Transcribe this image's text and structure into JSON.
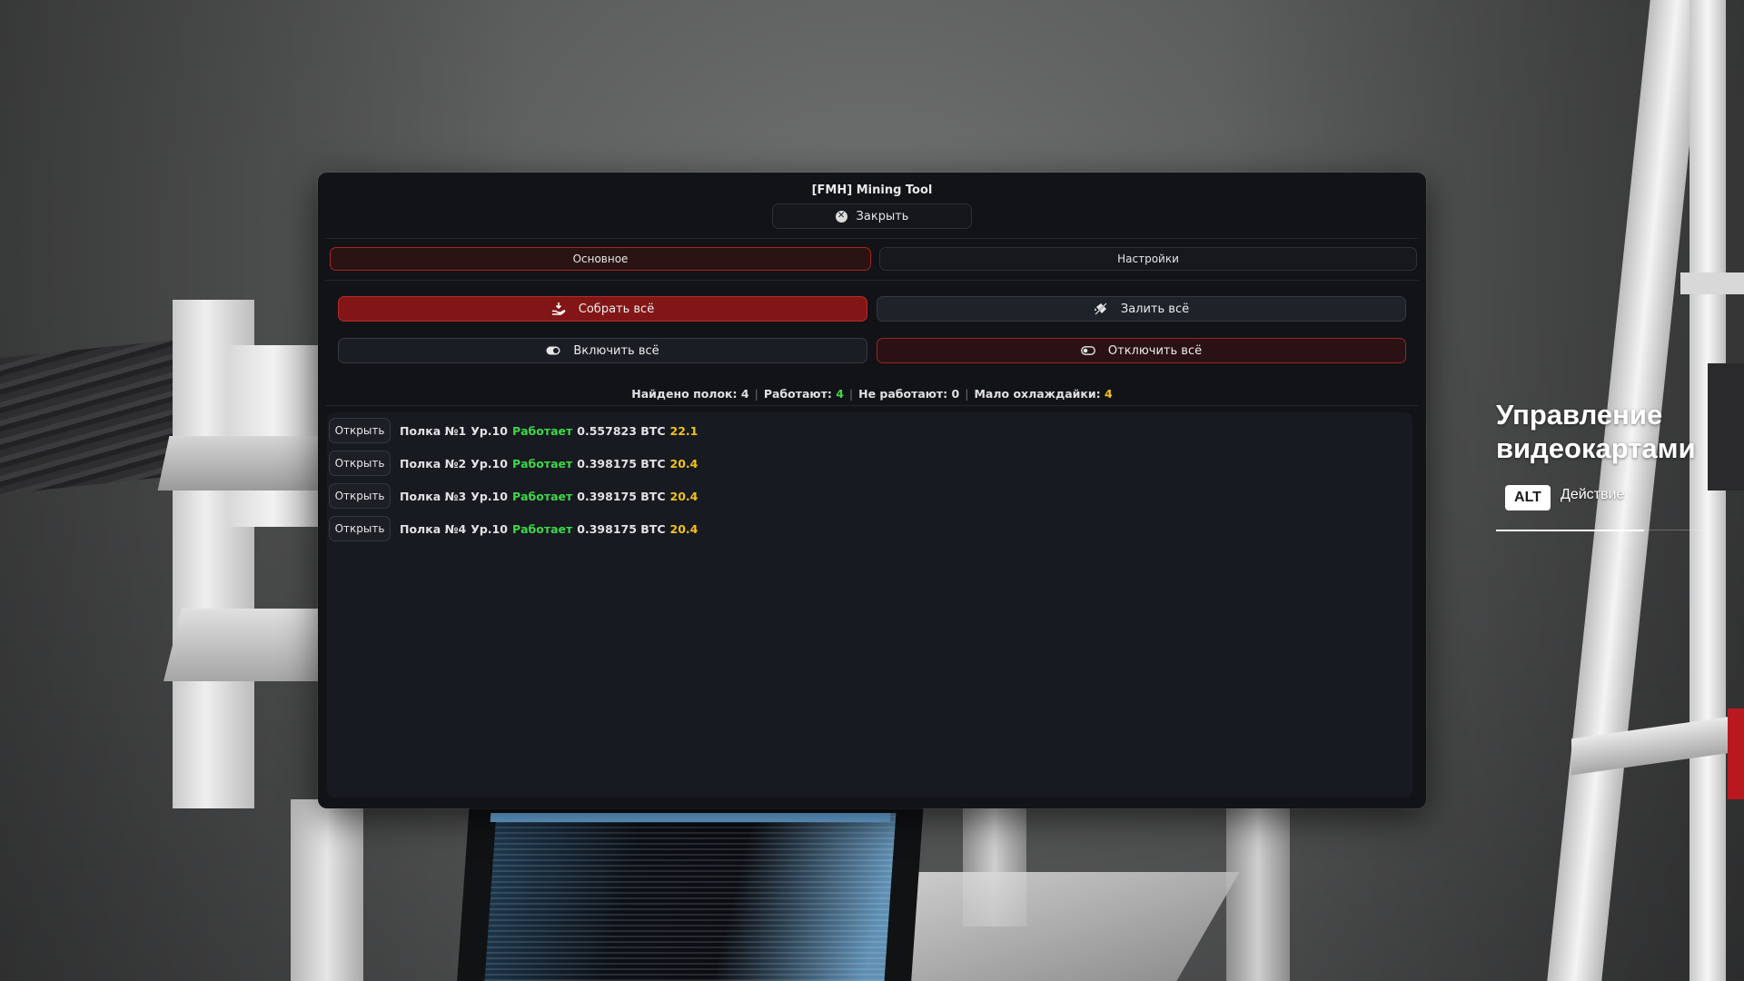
{
  "window": {
    "title": "[FMH] Mining Tool",
    "close_label": "Закрыть"
  },
  "tabs": [
    {
      "label": "Основное",
      "active": true
    },
    {
      "label": "Настройки",
      "active": false
    }
  ],
  "actions": {
    "collect_all": "Собрать всё",
    "fill_all": "Залить всё",
    "enable_all": "Включить всё",
    "disable_all": "Отключить всё"
  },
  "stats": {
    "found_label": "Найдено полок:",
    "found_value": "4",
    "working_label": "Работают:",
    "working_value": "4",
    "not_working_label": "Не работают:",
    "not_working_value": "0",
    "low_coolant_label": "Мало охлаждайки:",
    "low_coolant_value": "4"
  },
  "shelves": [
    {
      "open_label": "Открыть",
      "name": "Полка №1",
      "level": "Ур.10",
      "status": "Работает",
      "btc": "0.557823 BTC",
      "value": "22.1"
    },
    {
      "open_label": "Открыть",
      "name": "Полка №2",
      "level": "Ур.10",
      "status": "Работает",
      "btc": "0.398175 BTC",
      "value": "20.4"
    },
    {
      "open_label": "Открыть",
      "name": "Полка №3",
      "level": "Ур.10",
      "status": "Работает",
      "btc": "0.398175 BTC",
      "value": "20.4"
    },
    {
      "open_label": "Открыть",
      "name": "Полка №4",
      "level": "Ур.10",
      "status": "Работает",
      "btc": "0.398175 BTC",
      "value": "20.4"
    }
  ],
  "hud": {
    "title_line1": "Управление",
    "title_line2": "видеокартами",
    "key": "ALT",
    "action": "Действие"
  },
  "colors": {
    "accent_red": "#a82525",
    "status_green": "#3fd64a",
    "value_yellow": "#f2c21a",
    "panel_bg": "#111317"
  }
}
